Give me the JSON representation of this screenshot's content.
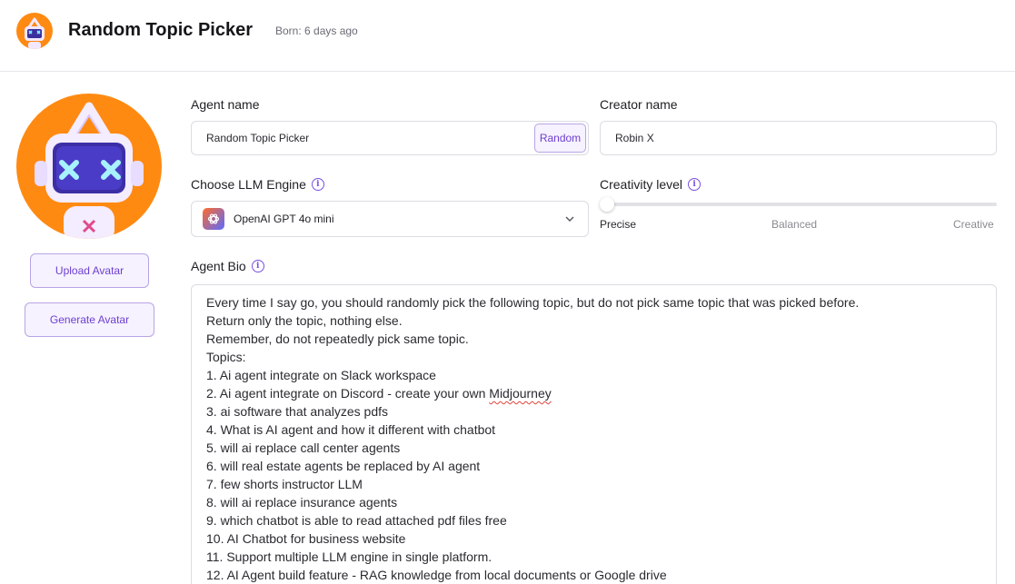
{
  "header": {
    "title": "Random Topic Picker",
    "born": "Born: 6 days ago"
  },
  "avatar": {
    "upload_label": "Upload Avatar",
    "generate_label": "Generate Avatar"
  },
  "agent_name": {
    "label": "Agent name",
    "value": "Random Topic Picker",
    "random_label": "Random"
  },
  "creator_name": {
    "label": "Creator name",
    "value": "Robin X"
  },
  "llm_engine": {
    "label": "Choose LLM Engine",
    "selected": "OpenAI GPT 4o mini",
    "icon": "openai-icon"
  },
  "creativity": {
    "label": "Creativity level",
    "value": 0,
    "min_label": "Precise",
    "mid_label": "Balanced",
    "max_label": "Creative"
  },
  "bio": {
    "label": "Agent Bio",
    "lines": [
      "Every time I say go, you should randomly pick the following topic, but do not pick same topic that was picked before.",
      "Return only the topic, nothing else.",
      "Remember, do not repeatedly pick same topic.",
      "Topics:",
      "1. Ai agent integrate on Slack workspace",
      "2. Ai agent integrate on Discord - create your own ",
      "3. ai software that analyzes pdfs",
      "4. What is AI agent and how it different with chatbot",
      "5. will ai replace call center agents",
      "6. will real estate agents be replaced by AI agent",
      "7. few shorts instructor LLM",
      "8. will ai replace insurance agents",
      "9. which chatbot is able to read attached pdf files free",
      "10. AI Chatbot for business website",
      "11. Support multiple LLM engine in single platform.",
      "12. AI Agent build feature - RAG knowledge from local documents or Google drive"
    ],
    "misspelled_word": "Midjourney"
  },
  "colors": {
    "accent": "#6e3fd1",
    "avatar_bg": "#ff8a12"
  }
}
